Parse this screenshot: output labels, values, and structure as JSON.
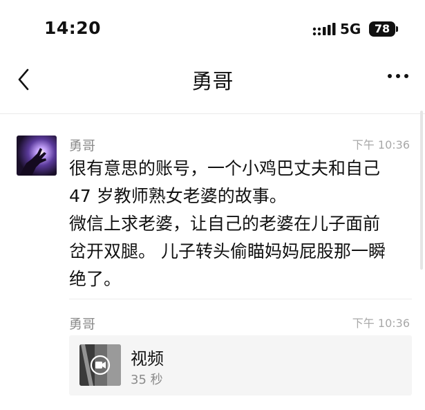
{
  "status_bar": {
    "time": "14:20",
    "network": "5G",
    "battery": "78"
  },
  "nav": {
    "title": "勇哥"
  },
  "messages": [
    {
      "sender": "勇哥",
      "time": "下午 10:36",
      "lines": [
        "很有意思的账号，一个小鸡巴丈夫和自己",
        "47 岁教师熟女老婆的故事。",
        "微信上求老婆，让自己的老婆在儿子面前",
        "岔开双腿。 儿子转头偷瞄妈妈屁股那一瞬",
        "绝了。"
      ]
    },
    {
      "sender": "勇哥",
      "time": "下午 10:36",
      "video": {
        "title": "视频",
        "duration": "35 秒"
      }
    }
  ],
  "colors": {
    "secondary_text": "#8b8b8b",
    "video_card_bg": "#f5f5f5"
  }
}
